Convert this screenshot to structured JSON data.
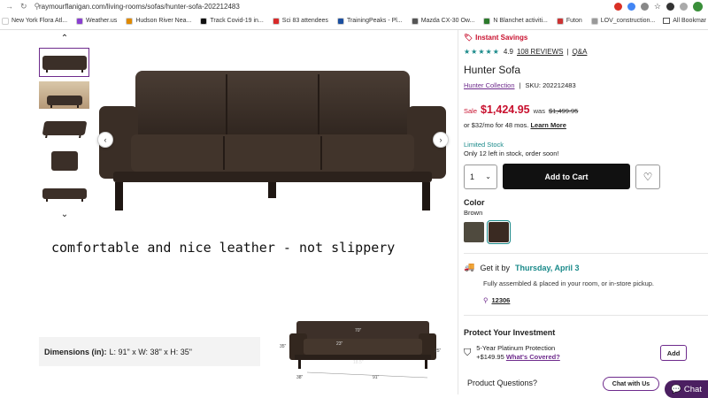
{
  "browser": {
    "url": "raymourflanigan.com/living-rooms/sofas/hunter-sofa-202212483",
    "bookmarks": [
      {
        "label": "New York Flora Atl...",
        "color": "#ffffff"
      },
      {
        "label": "Weather.us",
        "color": "#8a3fd1"
      },
      {
        "label": "Hudson River Nea...",
        "color": "#e08a00"
      },
      {
        "label": "Track Covid-19 in...",
        "color": "#111111"
      },
      {
        "label": "Sci 83 attendees",
        "color": "#d82a2a"
      },
      {
        "label": "TrainingPeaks - Pl...",
        "color": "#1b4fa0"
      },
      {
        "label": "Mazda CX-30 Ow...",
        "color": "#555555"
      },
      {
        "label": "N Blanchet activiti...",
        "color": "#2b7a2b"
      },
      {
        "label": "Futon",
        "color": "#cc3333"
      },
      {
        "label": "LOV_construction...",
        "color": "#999999"
      }
    ],
    "all_bookmarks": "All Bookmar"
  },
  "gallery": {
    "up_arrow": "⌃",
    "down_arrow": "⌄",
    "prev": "‹",
    "next": "›"
  },
  "caption": "comfortable and nice leather - not slippery",
  "dimensions": {
    "label": "Dimensions (in):",
    "value": "L: 91\" x W: 38\" x H: 35\"",
    "diagram": {
      "top": "70\"",
      "middle": "23\"",
      "seat": "18.5\"",
      "left": "35\"",
      "right": "25\"",
      "depth": "38\"",
      "length": "91\""
    }
  },
  "product": {
    "badge": "Instant Savings",
    "stars": "★★★★★",
    "rating": "4.9",
    "reviews": "108 REVIEWS",
    "qa": "Q&A",
    "name": "Hunter Sofa",
    "collection": "Hunter Collection",
    "sku": "SKU: 202212483",
    "sale_label": "Sale",
    "price": "$1,424.95",
    "was_label": "was",
    "was_price": "$1,499.95",
    "finance": "or $32/mo for 48 mos.",
    "learn_more": "Learn More",
    "stock_status": "Limited Stock",
    "stock_msg": "Only 12 left in stock, order soon!",
    "qty": "1",
    "add_to_cart": "Add to Cart",
    "color_heading": "Color",
    "color_value": "Brown",
    "swatches": [
      "#4f4a3e",
      "#3a2a22"
    ],
    "get_it": "Get it by",
    "delivery_date": "Thursday, April 3",
    "assembled": "Fully assembled & placed in your room, or in-store pickup.",
    "zip": "12306",
    "protect_heading": "Protect Your Investment",
    "plan_line1": "5-Year Platinum Protection",
    "plan_price": "+$149.95",
    "whats_covered": "What's Covered?",
    "add": "Add",
    "questions": "Product Questions?",
    "chat_with_us": "Chat with Us",
    "chat": "Chat"
  }
}
